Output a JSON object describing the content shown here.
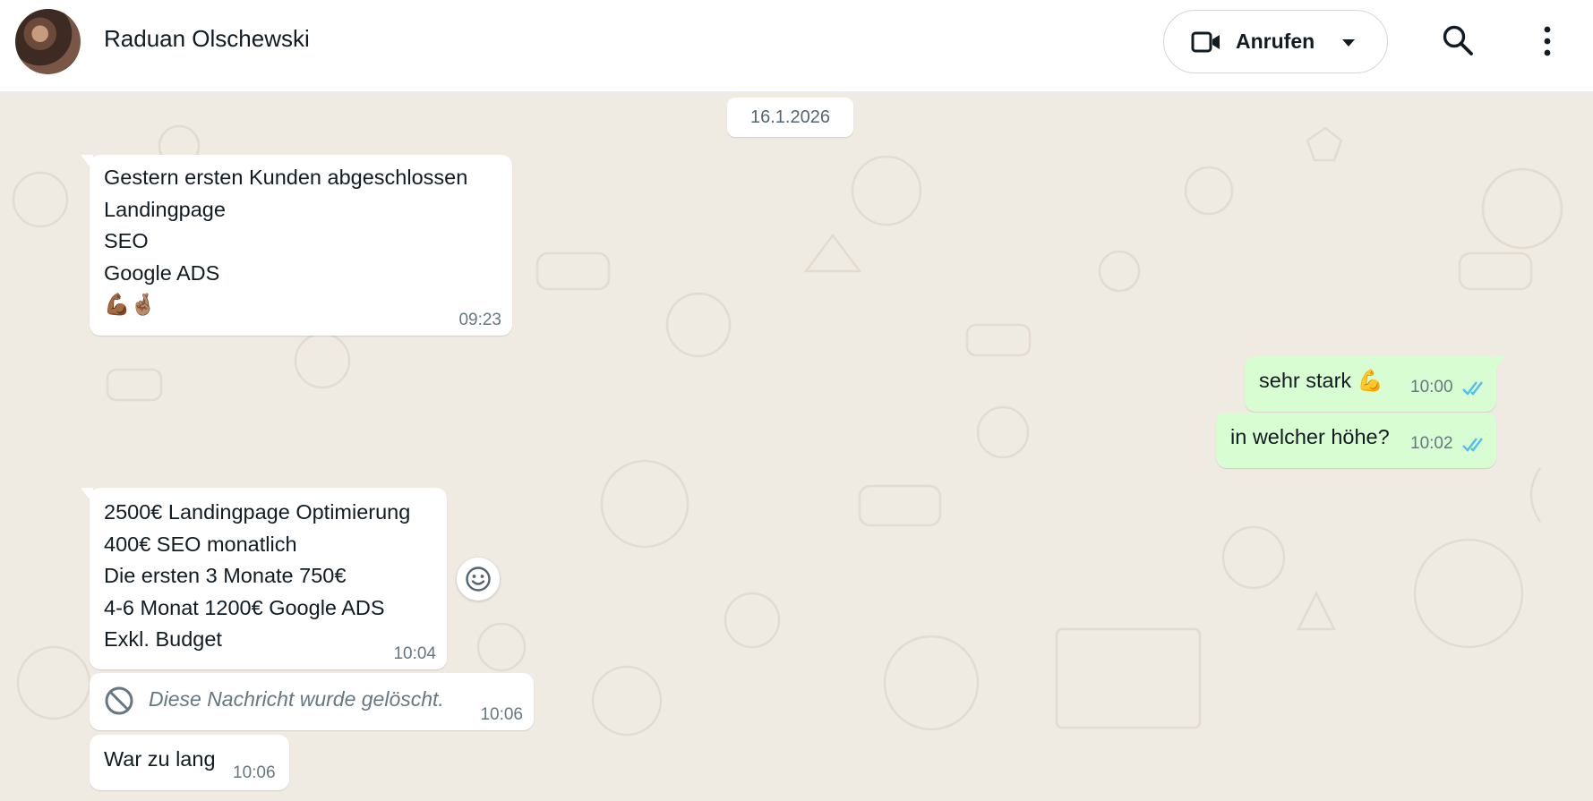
{
  "header": {
    "contact_name": "Raduan Olschewski",
    "call_label": "Anrufen",
    "icons": [
      "video-icon",
      "chevron-down-icon",
      "search-icon",
      "menu-icon"
    ]
  },
  "chat": {
    "date_chip": "16.1.2026",
    "messages": [
      {
        "direction": "incoming",
        "lines": [
          "Gestern ersten Kunden abgeschlossen",
          "Landingpage",
          "SEO",
          "Google ADS",
          "💪🏾🤞🏽"
        ],
        "time": "09:23"
      },
      {
        "direction": "outgoing",
        "text": "sehr stark 💪",
        "time": "10:00",
        "status": "read"
      },
      {
        "direction": "outgoing",
        "text": "in welcher höhe?",
        "time": "10:02",
        "status": "read"
      },
      {
        "direction": "incoming",
        "lines": [
          "2500€ Landingpage Optimierung",
          "400€ SEO monatlich",
          "Die ersten 3 Monate 750€",
          "4-6 Monat 1200€ Google ADS",
          "Exkl. Budget"
        ],
        "time": "10:04"
      },
      {
        "direction": "incoming",
        "deleted": true,
        "text": "Diese Nachricht wurde gelöscht.",
        "time": "10:06"
      },
      {
        "direction": "incoming",
        "text": "War zu lang",
        "time": "10:06"
      }
    ]
  },
  "colors": {
    "incoming_bubble": "#ffffff",
    "outgoing_bubble": "#d9fdd3",
    "chat_background": "#efeae2",
    "read_ticks": "#53bdeb",
    "meta_text": "#667781"
  }
}
